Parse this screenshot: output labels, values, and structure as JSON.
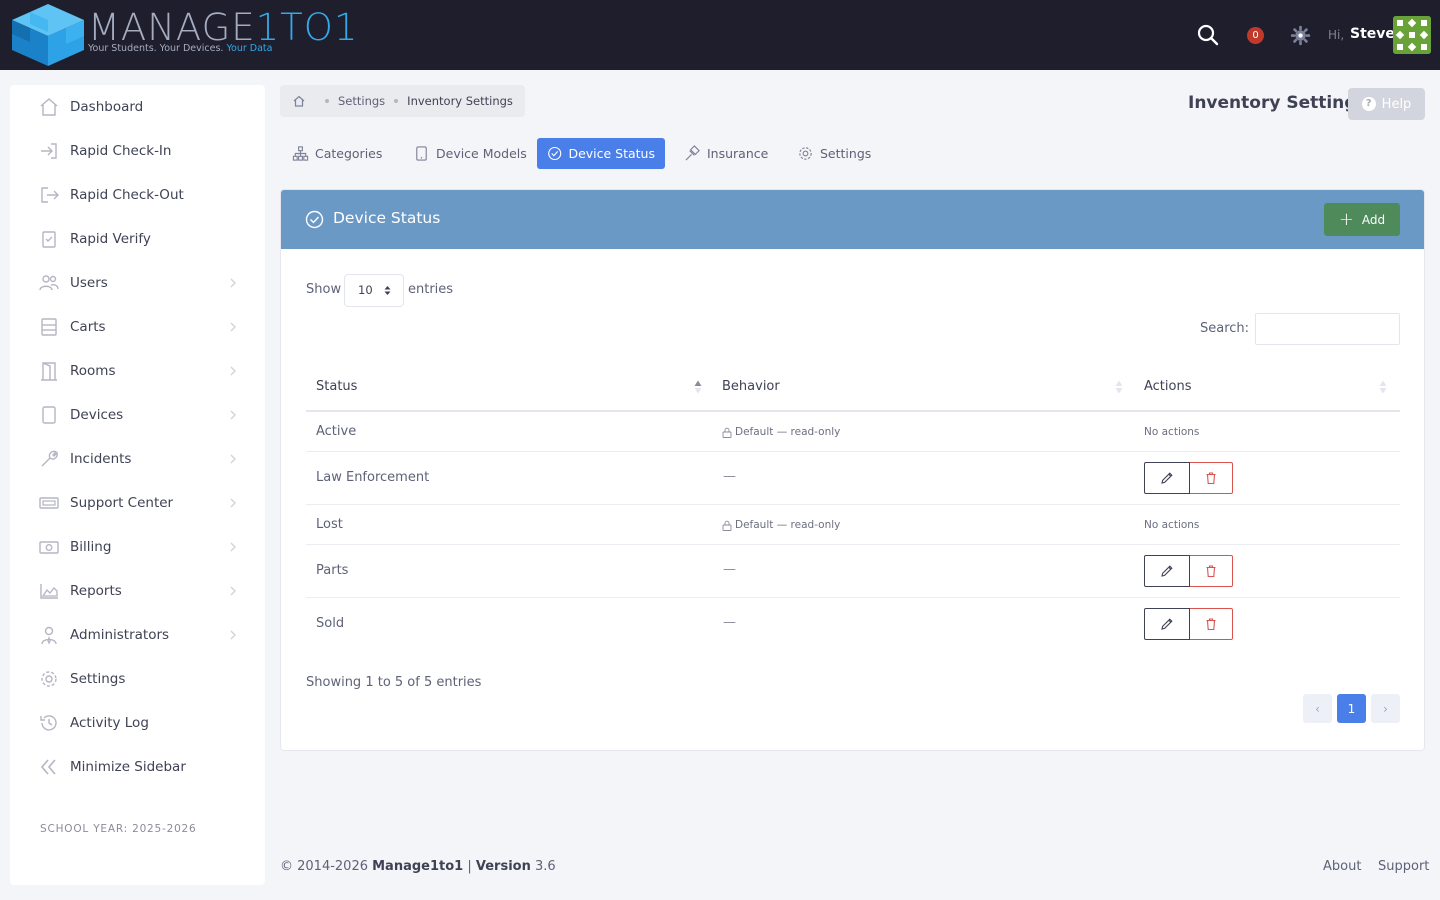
{
  "app": {
    "logo_text_1": "MANAGE",
    "logo_text_2": "1TO1",
    "tagline_1": "Your Students. Your Devices. ",
    "tagline_2": "Your Data",
    "colors": {
      "topbar": "#1e1e2d",
      "accent": "#4a7ee8",
      "card_header": "#6b99c6",
      "add_button": "#4f8a5a",
      "delete": "#d9534f"
    }
  },
  "topbar": {
    "notification_count": "0",
    "greeting": "Hi,",
    "user_name": "Steve"
  },
  "sidebar": {
    "items": [
      {
        "label": "Dashboard",
        "icon": "home-icon",
        "has_children": false
      },
      {
        "label": "Rapid Check-In",
        "icon": "sign-in-icon",
        "has_children": false
      },
      {
        "label": "Rapid Check-Out",
        "icon": "sign-out-icon",
        "has_children": false
      },
      {
        "label": "Rapid Verify",
        "icon": "clipboard-check-icon",
        "has_children": false
      },
      {
        "label": "Users",
        "icon": "users-icon",
        "has_children": true
      },
      {
        "label": "Carts",
        "icon": "cart-icon",
        "has_children": true
      },
      {
        "label": "Rooms",
        "icon": "door-icon",
        "has_children": true
      },
      {
        "label": "Devices",
        "icon": "tablet-icon",
        "has_children": true
      },
      {
        "label": "Incidents",
        "icon": "wrench-icon",
        "has_children": true
      },
      {
        "label": "Support Center",
        "icon": "ticket-icon",
        "has_children": true
      },
      {
        "label": "Billing",
        "icon": "money-icon",
        "has_children": true
      },
      {
        "label": "Reports",
        "icon": "chart-area-icon",
        "has_children": true
      },
      {
        "label": "Administrators",
        "icon": "user-tie-icon",
        "has_children": true
      },
      {
        "label": "Settings",
        "icon": "gear-icon",
        "has_children": false
      },
      {
        "label": "Activity Log",
        "icon": "history-icon",
        "has_children": false
      },
      {
        "label": "Minimize Sidebar",
        "icon": "double-chevron-left-icon",
        "has_children": false
      }
    ],
    "school_year": "SCHOOL YEAR: 2025-2026"
  },
  "breadcrumb": {
    "items": [
      "Settings",
      "Inventory Settings"
    ]
  },
  "page": {
    "title": "Inventory Settings",
    "help_label": "Help"
  },
  "tabs": [
    {
      "label": "Categories",
      "icon": "sitemap-icon",
      "active": false
    },
    {
      "label": "Device Models",
      "icon": "tablet-icon",
      "active": false
    },
    {
      "label": "Device Status",
      "icon": "check-circle-icon",
      "active": true
    },
    {
      "label": "Insurance",
      "icon": "gavel-icon",
      "active": false
    },
    {
      "label": "Settings",
      "icon": "gear-icon",
      "active": false
    }
  ],
  "card": {
    "title": "Device Status",
    "add_label": "Add",
    "show_label": "Show",
    "page_size": "10",
    "entries_label": "entries",
    "search_label": "Search:",
    "search_value": "",
    "columns": [
      "Status",
      "Behavior",
      "Actions"
    ],
    "rows": [
      {
        "status": "Active",
        "behavior": "Default — read-only",
        "actions": "No actions",
        "editable": false
      },
      {
        "status": "Law Enforcement",
        "behavior": "—",
        "actions": "",
        "editable": true
      },
      {
        "status": "Lost",
        "behavior": "Default — read-only",
        "actions": "No actions",
        "editable": false
      },
      {
        "status": "Parts",
        "behavior": "—",
        "actions": "",
        "editable": true
      },
      {
        "status": "Sold",
        "behavior": "—",
        "actions": "",
        "editable": true
      }
    ],
    "info": "Showing 1 to 5 of 5 entries",
    "pagination": {
      "current": "1",
      "prev": "‹",
      "next": "›"
    }
  },
  "footer": {
    "copyright": "© 2014-2026 ",
    "brand": "Manage1to1",
    "separator": " | ",
    "version_label": "Version",
    "version": " 3.6",
    "links": [
      "About",
      "Support"
    ]
  }
}
